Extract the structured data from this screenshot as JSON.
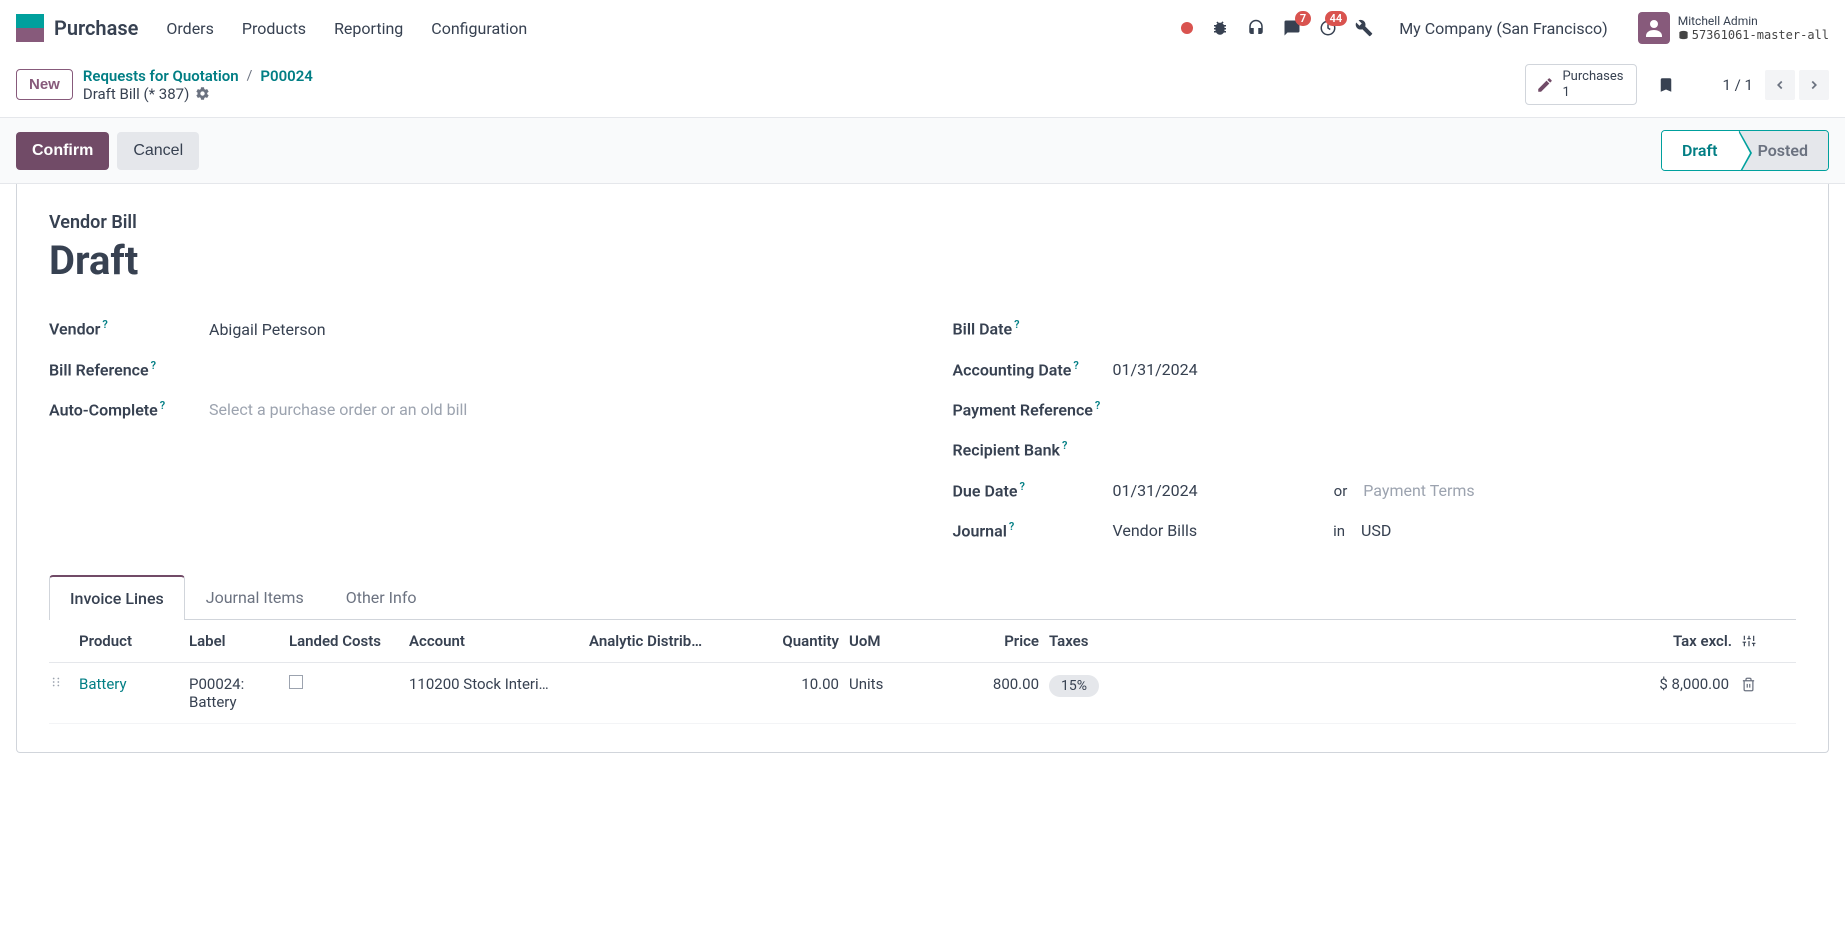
{
  "app": {
    "name": "Purchase"
  },
  "nav": {
    "orders": "Orders",
    "products": "Products",
    "reporting": "Reporting",
    "configuration": "Configuration"
  },
  "topbar": {
    "messages_badge": "7",
    "activities_badge": "44",
    "company": "My Company (San Francisco)",
    "user_name": "Mitchell Admin",
    "db_name": "57361061-master-all"
  },
  "breadcrumb": {
    "new": "New",
    "rfq": "Requests for Quotation",
    "po": "P00024",
    "current": "Draft Bill (* 387)"
  },
  "smartbutton": {
    "label": "Purchases",
    "count": "1"
  },
  "pager": {
    "text": "1 / 1"
  },
  "buttons": {
    "confirm": "Confirm",
    "cancel": "Cancel"
  },
  "status": {
    "draft": "Draft",
    "posted": "Posted"
  },
  "sheet": {
    "title_label": "Vendor Bill",
    "title": "Draft",
    "labels": {
      "vendor": "Vendor",
      "bill_ref": "Bill Reference",
      "autocomplete": "Auto-Complete",
      "bill_date": "Bill Date",
      "acc_date": "Accounting Date",
      "pay_ref": "Payment Reference",
      "rec_bank": "Recipient Bank",
      "due_date": "Due Date",
      "journal": "Journal"
    },
    "values": {
      "vendor": "Abigail Peterson",
      "autocomplete_ph": "Select a purchase order or an old bill",
      "acc_date": "01/31/2024",
      "due_date": "01/31/2024",
      "due_or": "or",
      "due_terms_ph": "Payment Terms",
      "journal": "Vendor Bills",
      "journal_in": "in",
      "journal_cur": "USD"
    }
  },
  "tabs": {
    "lines": "Invoice Lines",
    "journal": "Journal Items",
    "other": "Other Info"
  },
  "table": {
    "headers": {
      "product": "Product",
      "label": "Label",
      "landed": "Landed Costs",
      "account": "Account",
      "analytic": "Analytic Distrib…",
      "qty": "Quantity",
      "uom": "UoM",
      "price": "Price",
      "taxes": "Taxes",
      "taxexcl": "Tax excl."
    },
    "row": {
      "product": "Battery",
      "label": "P00024: Battery",
      "account": "110200 Stock Interi…",
      "qty": "10.00",
      "uom": "Units",
      "price": "800.00",
      "tax": "15%",
      "total": "$ 8,000.00"
    }
  }
}
